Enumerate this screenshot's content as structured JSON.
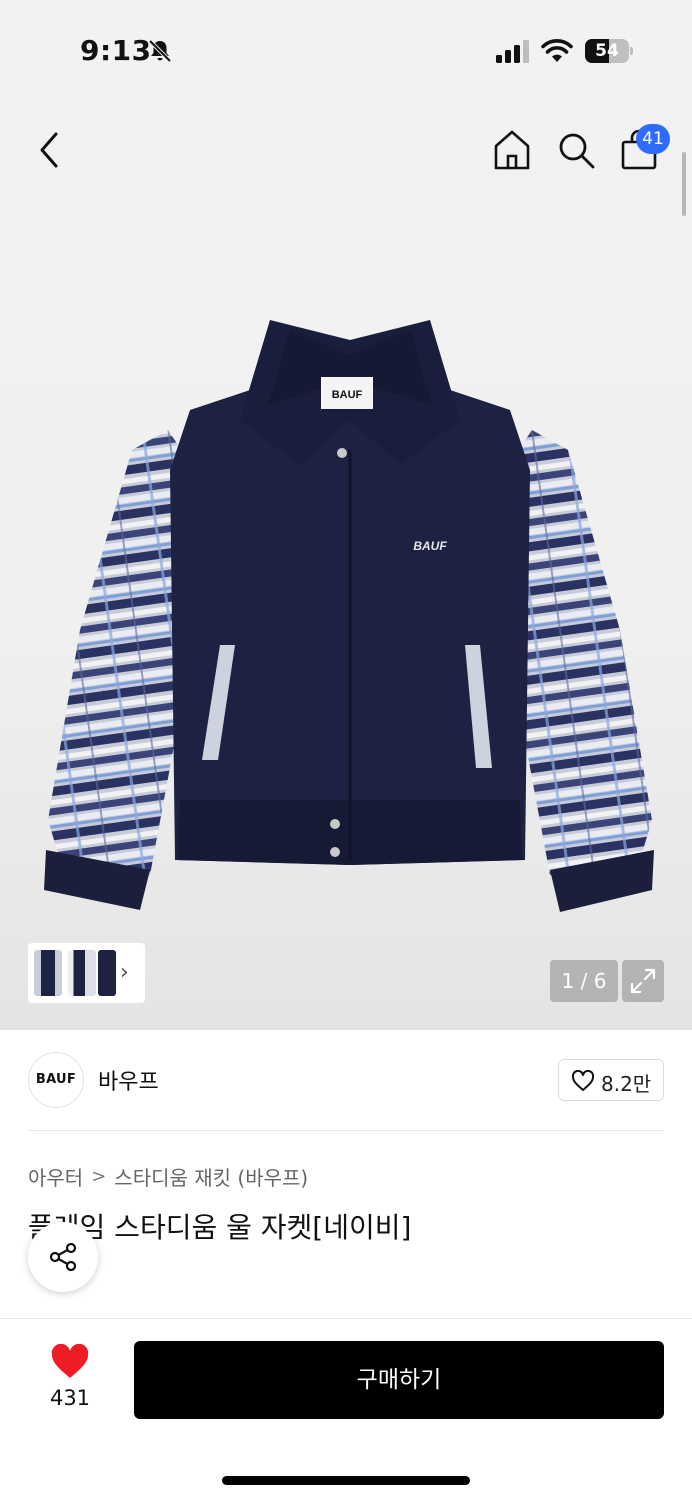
{
  "status_bar": {
    "time": "9:13",
    "battery_percent": 54,
    "battery_text": "54"
  },
  "header": {
    "cart_badge_count": "41"
  },
  "gallery": {
    "page_indicator": "1 / 6",
    "thumbnail_arrow": "›",
    "current_image": 1,
    "total_images": 6,
    "logo_tag_text": "BAUF",
    "chest_logo_text": "BAUF"
  },
  "brand": {
    "logo_text": "BAUF",
    "name": "바우프",
    "likes": "8.2만"
  },
  "product": {
    "breadcrumb": [
      "아우터",
      "스타디움 재킷 (바우프)"
    ],
    "breadcrumb_separator": ">",
    "title": "플레임 스타디움 울 자켓[네이비]"
  },
  "bottom_bar": {
    "wish_count": "431",
    "buy_label": "구매하기"
  },
  "colors": {
    "accent_blue": "#2f6bff",
    "heart_red": "#ee1c25",
    "navy": "#1b1f3b",
    "buy_button": "#000000"
  },
  "icons": [
    "bell-slash-icon",
    "signal-icon",
    "wifi-icon",
    "back-icon",
    "home-icon",
    "search-icon",
    "cart-icon",
    "expand-icon",
    "heart-outline-icon",
    "share-icon",
    "heart-filled-icon"
  ]
}
